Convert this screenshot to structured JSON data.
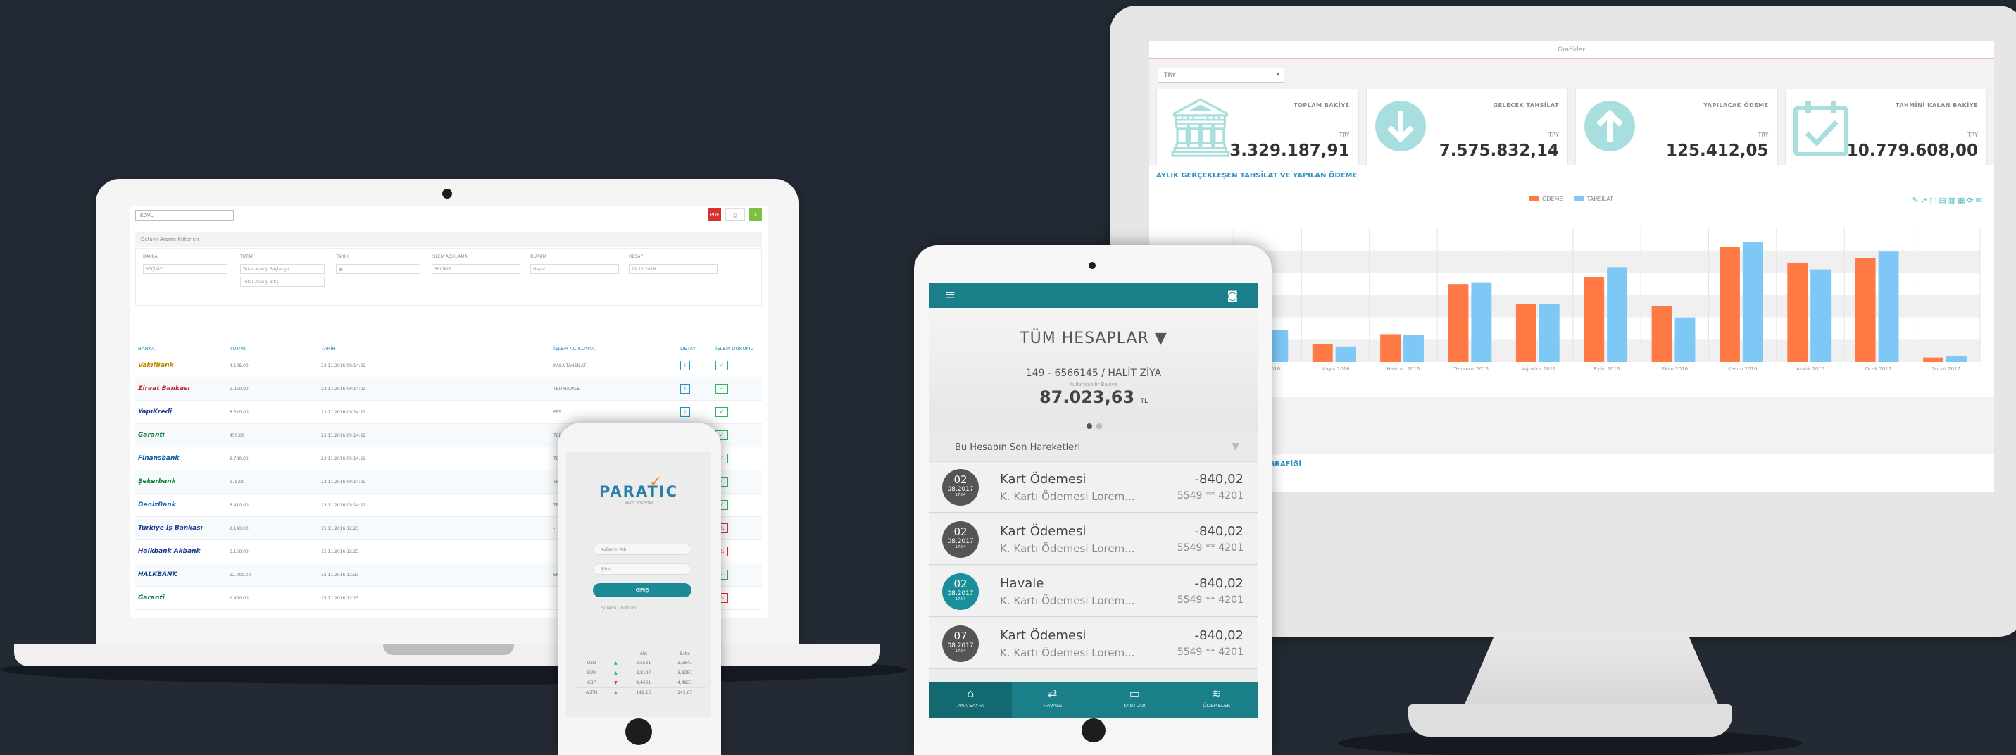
{
  "monitor": {
    "header_text": "Grafikler",
    "currency_select": "TRY",
    "cards": [
      {
        "label": "TOPLAM BAKİYE",
        "currency": "TRY",
        "value": "3.329.187,91",
        "icon": "bank-icon"
      },
      {
        "label": "GELECEK TAHSİLAT",
        "currency": "TRY",
        "value": "7.575.832,14",
        "icon": "arrow-down-icon"
      },
      {
        "label": "YAPILACAK ÖDEME",
        "currency": "TRY",
        "value": "125.412,05",
        "icon": "arrow-up-icon"
      },
      {
        "label": "TAHMİNİ KALAN BAKİYE",
        "currency": "TRY",
        "value": "10.779.608,00",
        "icon": "calendar-check-icon"
      }
    ],
    "chart_title": "AYLIK GERÇEKLEŞEN TAHSİLAT VE YAPILAN ÖDEME",
    "bottom_panel_title": "GRAFİĞİ",
    "colors": {
      "series1": "#ff7a45",
      "series2": "#7ec8f5",
      "accent": "#2c8fc1"
    }
  },
  "chart_data": {
    "type": "bar",
    "categories": [
      "Mart 2016",
      "Mayıs 2016",
      "Haziran 2016",
      "Temmuz 2016",
      "Ağustos 2016",
      "Eylül 2016",
      "Ekim 2016",
      "Kasım 2016",
      "Aralık 2016",
      "Ocak 2017",
      "Şubat 2017"
    ],
    "series": [
      {
        "name": "ÖDEME",
        "values": [
          28,
          16,
          25,
          70,
          52,
          76,
          50,
          103,
          89,
          93,
          4
        ]
      },
      {
        "name": "TAHSİLAT",
        "values": [
          29,
          14,
          24,
          71,
          52,
          85,
          40,
          108,
          83,
          99,
          5
        ]
      }
    ],
    "grid": true,
    "legend_position": "top-center"
  },
  "laptop": {
    "filter_value": "KDVLİ",
    "band_label": "Detaylı Arama Kriterleri",
    "form_fields": [
      {
        "label": "BANKA",
        "value": "SEÇİNİZ"
      },
      {
        "label": "TUTAR",
        "value": "Tutar Aralığı Başlangıç"
      },
      {
        "label": "TARİH",
        "value": "Tutar Aralığı Bitiş"
      },
      {
        "label": "İŞLEM AÇIKLAMA",
        "value": "SEÇİNİZ"
      },
      {
        "label": "DURUM",
        "value": "Hepsi"
      },
      {
        "label": "HESAP",
        "value": "22.11.2016"
      }
    ],
    "columns": [
      "BANKA",
      "TUTAR",
      "TARİH",
      "İŞLEM AÇIKLAMA",
      "DETAY",
      "İŞLEM DURUMU"
    ],
    "rows": [
      {
        "bank": "VakıfBank",
        "color": "#b88a00",
        "amount": "4.125,00",
        "date": "23.11.2016 09:14:22",
        "desc": "KASA TAHSİLAT",
        "ok": true
      },
      {
        "bank": "Ziraat Bankası",
        "color": "#c0272d",
        "amount": "1.250,00",
        "date": "23.11.2016 09:14:22",
        "desc": "TED HAVALE",
        "ok": true
      },
      {
        "bank": "YapıKredi",
        "color": "#1c3f94",
        "amount": "8.320,00",
        "date": "23.11.2016 09:14:22",
        "desc": "EFT",
        "ok": true
      },
      {
        "bank": "Garanti",
        "color": "#107c41",
        "amount": "450,00",
        "date": "23.11.2016 09:14:22",
        "desc": "TED",
        "ok": true
      },
      {
        "bank": "Finansbank",
        "color": "#0a5aa8",
        "amount": "2.780,00",
        "date": "23.11.2016 09:14:22",
        "desc": "TED",
        "ok": true
      },
      {
        "bank": "Şekerbank",
        "color": "#107c41",
        "amount": "975,00",
        "date": "23.11.2016 09:14:22",
        "desc": "TED",
        "ok": true
      },
      {
        "bank": "DenizBank",
        "color": "#1565c0",
        "amount": "6.410,00",
        "date": "23.11.2016 09:14:22",
        "desc": "TED",
        "ok": true
      },
      {
        "bank": "Türkiye İş Bankası",
        "color": "#1a3f8f",
        "amount": "2.143,00",
        "date": "15.11.2016 12:23",
        "desc": "-",
        "ok": false
      },
      {
        "bank": "Halkbank Akbank",
        "color": "#1a3f8f",
        "amount": "3.150,00",
        "date": "15.11.2016 12:23",
        "desc": "",
        "ok": false
      },
      {
        "bank": "HALKBANK",
        "color": "#1a3f8f",
        "amount": "12.000,00",
        "date": "15.11.2016 12:23",
        "desc": "EK",
        "ok": true
      },
      {
        "bank": "Garanti",
        "color": "#107c41",
        "amount": "1.900,00",
        "date": "15.11.2016 12:23",
        "desc": "",
        "ok": false
      }
    ]
  },
  "phone": {
    "logo_text": "PARATIC",
    "logo_sub": "NAKİT YÖNETİMİ",
    "username_placeholder": "Kullanıcı Adı",
    "password_placeholder": "Şifre",
    "login_button": "GİRİŞ",
    "forgot_link": "Şifremi Unuttum",
    "fx_headers": [
      "",
      "",
      "Alış",
      "Satış"
    ],
    "fx_rows": [
      {
        "cur": "USD",
        "arrow": "▲",
        "arrow_color": "#2ab55b",
        "buy": "3,5521",
        "sell": "3,5641"
      },
      {
        "cur": "EUR",
        "arrow": "▲",
        "arrow_color": "#2ab55b",
        "buy": "3,8127",
        "sell": "3,8251"
      },
      {
        "cur": "GBP",
        "arrow": "▼",
        "arrow_color": "#d32f2f",
        "buy": "4,4601",
        "sell": "4,4831"
      },
      {
        "cur": "ALTIN",
        "arrow": "▲",
        "arrow_color": "#2ab55b",
        "buy": "142,15",
        "sell": "142,67"
      }
    ]
  },
  "tablet": {
    "title": "TÜM HESAPLAR",
    "account": "149 - 6566145 / HALİT ZİYA",
    "balance_label": "Kullanılabilir Bakiye",
    "balance": "87.023,63",
    "balance_currency": "TL",
    "section_title": "Bu Hesabın Son Hareketleri",
    "transactions": [
      {
        "day": "02",
        "month": "08.2017",
        "time": "17:04",
        "title": "Kart Ödemesi",
        "desc": "K. Kartı Ödemesi Lorem...",
        "amount": "-840,02",
        "card": "5549 ** 4201",
        "color": "#555555"
      },
      {
        "day": "02",
        "month": "08.2017",
        "time": "17:04",
        "title": "Kart Ödemesi",
        "desc": "K. Kartı Ödemesi Lorem...",
        "amount": "-840,02",
        "card": "5549 ** 4201",
        "color": "#555555"
      },
      {
        "day": "02",
        "month": "08.2017",
        "time": "17:04",
        "title": "Havale",
        "desc": "K. Kartı Ödemesi Lorem...",
        "amount": "-840,02",
        "card": "5549 ** 4201",
        "color": "#1a8f99"
      },
      {
        "day": "07",
        "month": "08.2017",
        "time": "17:04",
        "title": "Kart Ödemesi",
        "desc": "K. Kartı Ödemesi Lorem...",
        "amount": "-840,02",
        "card": "5549 ** 4201",
        "color": "#555555"
      }
    ],
    "nav": [
      {
        "label": "ANA SAYFA",
        "icon": "⌂"
      },
      {
        "label": "HAVALE",
        "icon": "⇄"
      },
      {
        "label": "KARTLAR",
        "icon": "▭"
      },
      {
        "label": "ÖDEMELER",
        "icon": "≋"
      }
    ]
  }
}
